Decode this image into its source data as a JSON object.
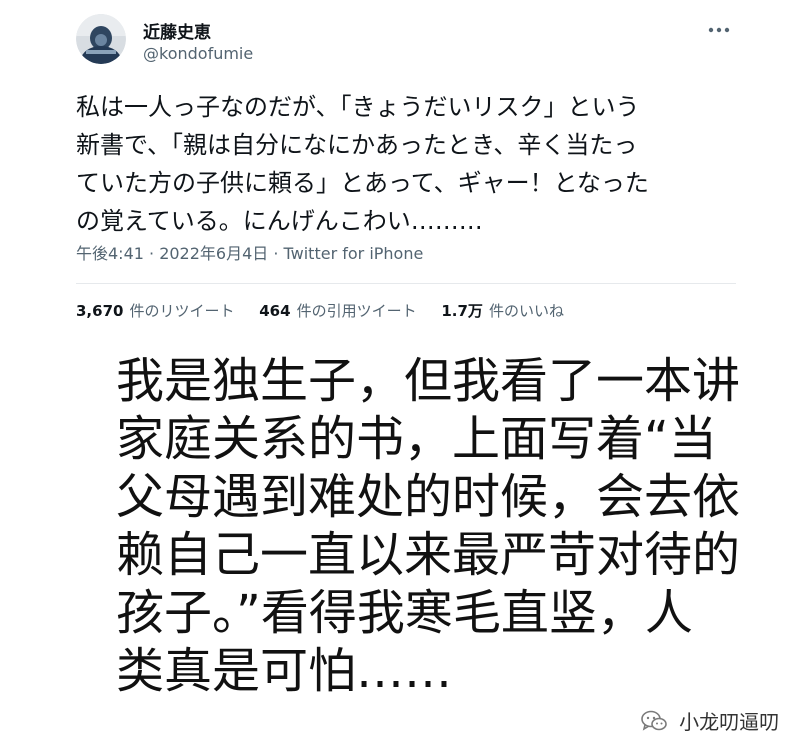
{
  "tweet": {
    "author_name": "近藤史恵",
    "author_handle": "@kondofumie",
    "text_lines": [
      "私は一人っ子なのだが、「きょうだいリスク」という",
      "新書で、「親は自分になにかあったとき、辛く当たっ",
      "ていた方の子供に頼る」とあって、ギャー！となった",
      "の覚えている。にんげんこわい………"
    ],
    "meta": "午後4:41 · 2022年6月4日 · Twitter for iPhone",
    "stats": [
      {
        "number": "3,670",
        "label": "件のリツイート"
      },
      {
        "number": "464",
        "label": "件の引用ツイート"
      },
      {
        "number": "1.7万",
        "label": "件のいいね"
      }
    ],
    "more_icon": "more-dots-icon"
  },
  "translation": {
    "lines": [
      "我是独生子，但我看了一本讲",
      "家庭关系的书，上面写着“当",
      "父母遇到难处的时候，会去依",
      "赖自己一直以来最严苛对待的",
      "孩子。”看得我寒毛直竖，人",
      "类真是可怕……"
    ]
  },
  "watermark": {
    "text": "小龙叨逼叨",
    "icon": "wechat-icon"
  },
  "colors": {
    "text_primary": "#0f1419",
    "text_secondary": "#536471",
    "divider": "#e6e9ec",
    "background": "#ffffff"
  }
}
